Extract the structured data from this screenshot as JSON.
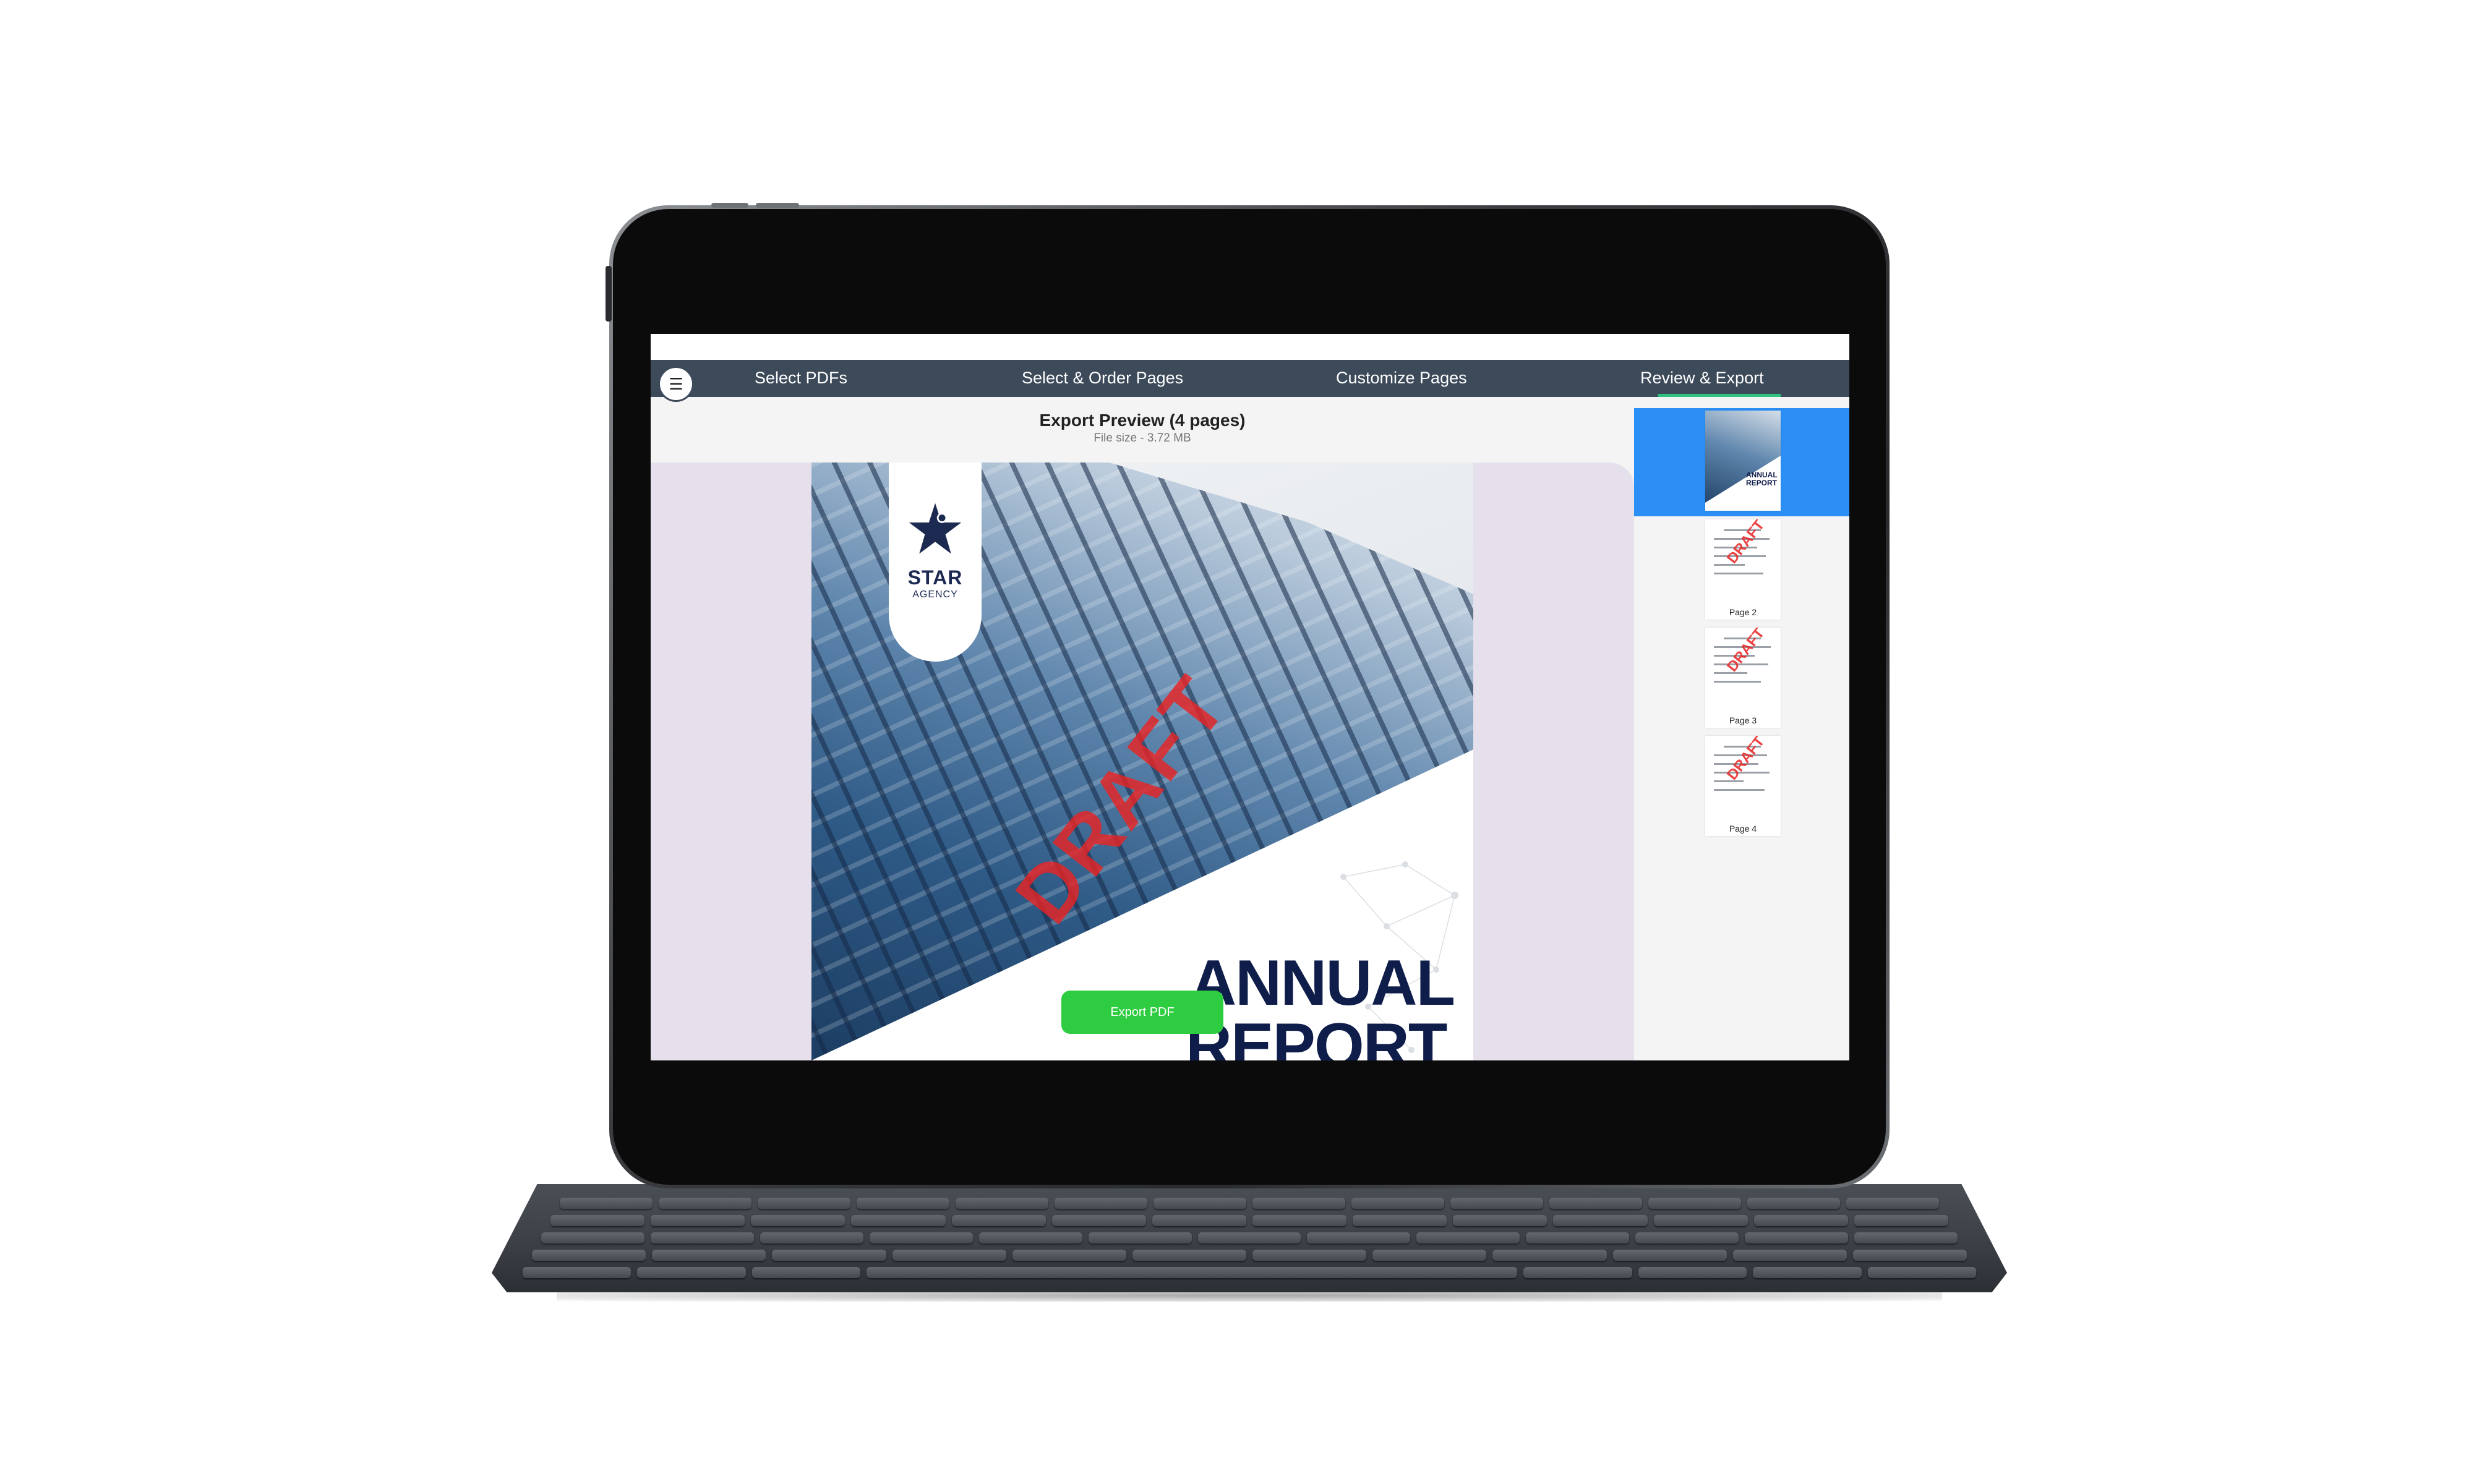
{
  "tabs": [
    {
      "label": "Select PDFs"
    },
    {
      "label": "Select & Order Pages"
    },
    {
      "label": "Customize Pages"
    },
    {
      "label": "Review & Export",
      "active": true
    }
  ],
  "menu": {
    "icon": "hamburger-menu-icon"
  },
  "preview": {
    "title": "Export Preview (4 pages)",
    "file_size": "File size - 3.72 MB"
  },
  "cover_page": {
    "logo_line1": "STAR",
    "logo_line2": "AGENCY",
    "title_line1": "ANNUAL",
    "title_line2": "REPORT",
    "watermark": "DRAFT"
  },
  "export_button": {
    "label": "Export PDF"
  },
  "thumbnails": [
    {
      "label": "",
      "selected": true,
      "title_line1": "ANNUAL",
      "title_line2": "REPORT"
    },
    {
      "label": "Page 2",
      "selected": false,
      "watermark": "DRAFT"
    },
    {
      "label": "Page 3",
      "selected": false,
      "watermark": "DRAFT"
    },
    {
      "label": "Page 4",
      "selected": false,
      "watermark": "DRAFT"
    }
  ],
  "colors": {
    "nav_bar": "#3d4a5a",
    "active_tab_underline": "#2ec27e",
    "selected_thumbnail": "#2b8ff5",
    "export_button": "#2ecc40",
    "watermark": "#e82323",
    "preview_background": "#e6e0ec",
    "title_text": "#0f1d4a"
  }
}
